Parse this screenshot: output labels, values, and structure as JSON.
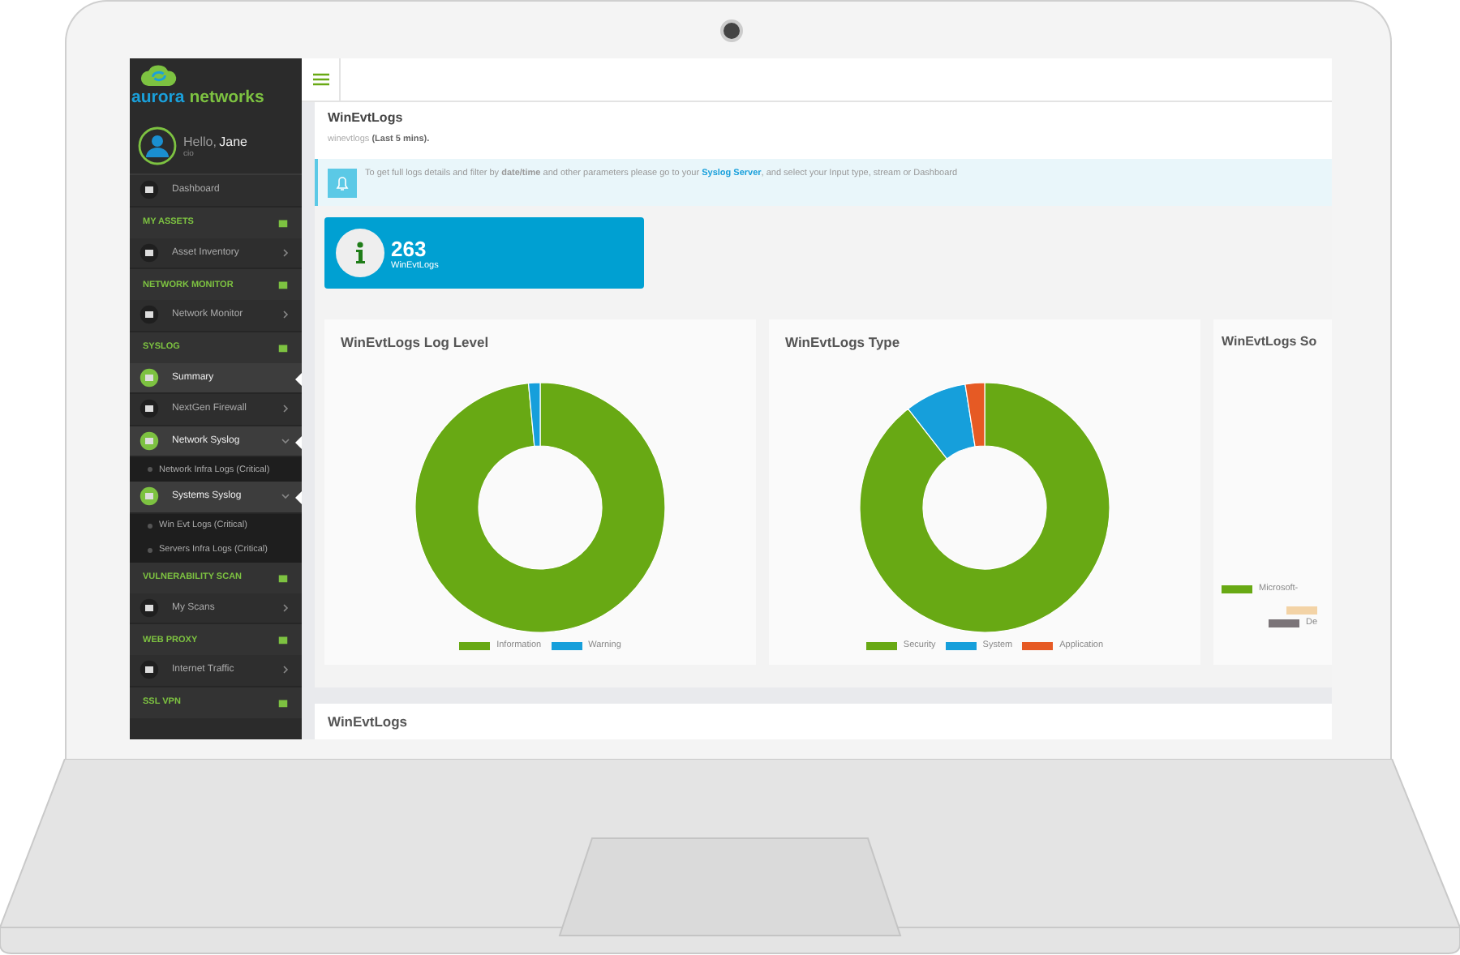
{
  "sidebar": {
    "logo": {
      "word_1": "aurora",
      "word_2": "networks"
    },
    "user": {
      "greeting": "Hello,",
      "name": "Jane",
      "role": "cio"
    },
    "items": [
      {
        "kind": "item",
        "label": "Dashboard",
        "selected": false,
        "chevron": false
      },
      {
        "kind": "section",
        "label": "MY ASSETS"
      },
      {
        "kind": "item",
        "label": "Asset Inventory",
        "selected": false,
        "chevron": true
      },
      {
        "kind": "section",
        "label": "NETWORK MONITOR"
      },
      {
        "kind": "item",
        "label": "Network Monitor",
        "selected": false,
        "chevron": true
      },
      {
        "kind": "section",
        "label": "SYSLOG"
      },
      {
        "kind": "item",
        "label": "Summary",
        "selected": true,
        "chevron": false
      },
      {
        "kind": "item",
        "label": "NextGen Firewall",
        "selected": false,
        "chevron": true
      },
      {
        "kind": "group",
        "label": "Network Syslog",
        "expanded": true,
        "children": [
          {
            "label": "Network Infra Logs (Critical)"
          }
        ]
      },
      {
        "kind": "group",
        "label": "Systems Syslog",
        "expanded": true,
        "children": [
          {
            "label": "Win Evt Logs (Critical)"
          },
          {
            "label": "Servers Infra Logs (Critical)"
          }
        ]
      },
      {
        "kind": "section",
        "label": "VULNERABILITY SCAN"
      },
      {
        "kind": "item",
        "label": "My Scans",
        "selected": false,
        "chevron": true
      },
      {
        "kind": "section",
        "label": "WEB PROXY"
      },
      {
        "kind": "item",
        "label": "Internet Traffic",
        "selected": false,
        "chevron": true
      },
      {
        "kind": "section",
        "label": "SSL VPN"
      }
    ]
  },
  "header": {
    "title": "WinEvtLogs",
    "subtitle": "winevtlogs **(Last 5 mins).**"
  },
  "alert": {
    "text_before": "To get full logs details and filter by **date/time** and other parameters please go to your",
    "link": "Syslog Server",
    "text_after": ", and select your Input type, stream or Dashboard"
  },
  "stat": {
    "value": "263",
    "label": "WinEvtLogs"
  },
  "cards": [
    {
      "kind": "donut",
      "title": "WinEvtLogs Log Level",
      "legend": [
        {
          "label": "Information",
          "color": "#68a914"
        },
        {
          "label": "Warning",
          "color": "#169fdb"
        }
      ]
    },
    {
      "kind": "donut",
      "title": "WinEvtLogs Type",
      "legend": [
        {
          "label": "Security",
          "color": "#68a914"
        },
        {
          "label": "System",
          "color": "#169fdb"
        },
        {
          "label": "Application",
          "color": "#e65a24"
        }
      ]
    },
    {
      "kind": "list",
      "title": "WinEvtLogs So",
      "legend": [
        {
          "label": "Microsoft-",
          "color": "#68a914"
        },
        {
          "color": "#f3d3a6"
        },
        {
          "label": "De",
          "color": "#7b7478"
        }
      ]
    }
  ],
  "bottom_card": {
    "title": "WinEvtLogs"
  }
}
